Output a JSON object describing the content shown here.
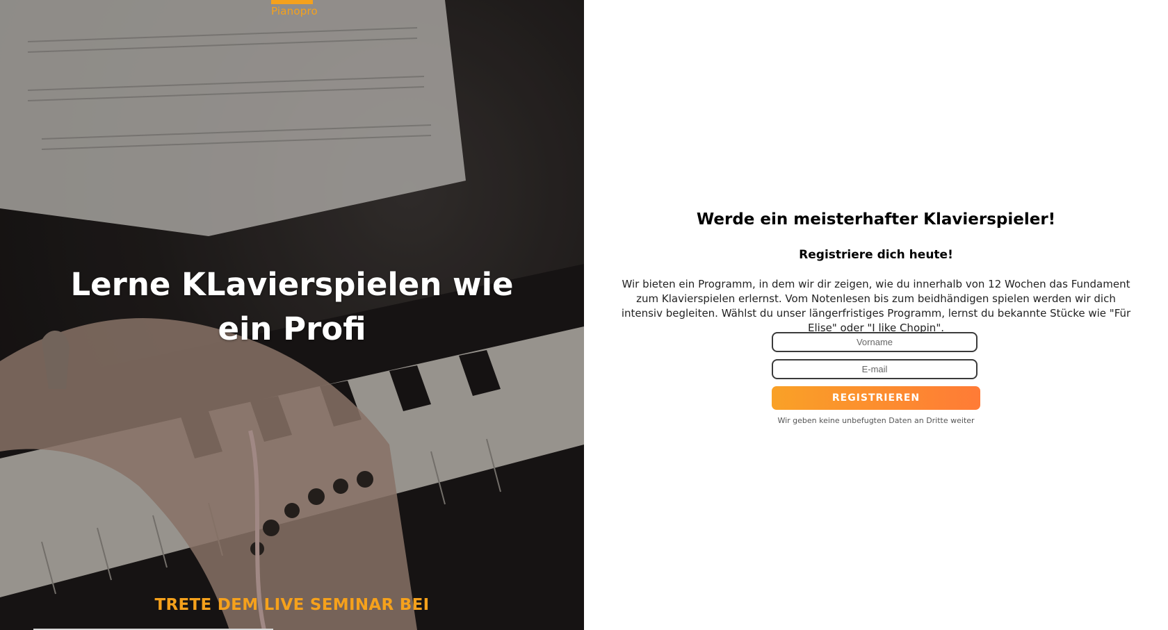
{
  "brand": {
    "name": "Pianopro",
    "accent_color": "#f5a11c"
  },
  "hero": {
    "title": "Lerne KLavierspielen wie ein Profi",
    "cta": "TRETE DEM LIVE SEMINAR BEI",
    "background_image": "hands-playing-piano-photo"
  },
  "signup": {
    "heading": "Werde ein meisterhafter Klavierspieler!",
    "subheading": "Registriere dich heute!",
    "body": "Wir bieten ein Programm, in dem wir dir zeigen, wie du innerhalb von 12 Wochen das Fundament zum Klavierspielen erlernst. Vom Notenlesen bis zum beidhändigen spielen werden wir dich intensiv begleiten. Wählst du unser längerfristiges Programm, lernst du bekannte Stücke wie \"Für Elise\" oder \"I like Chopin\".",
    "firstname_placeholder": "Vorname",
    "email_placeholder": "E-mail",
    "register_label": "REGISTRIEREN",
    "privacy_note": "Wir geben keine unbefugten Daten an Dritte weiter",
    "button_gradient": [
      "#f9a127",
      "#ff7b36"
    ]
  }
}
